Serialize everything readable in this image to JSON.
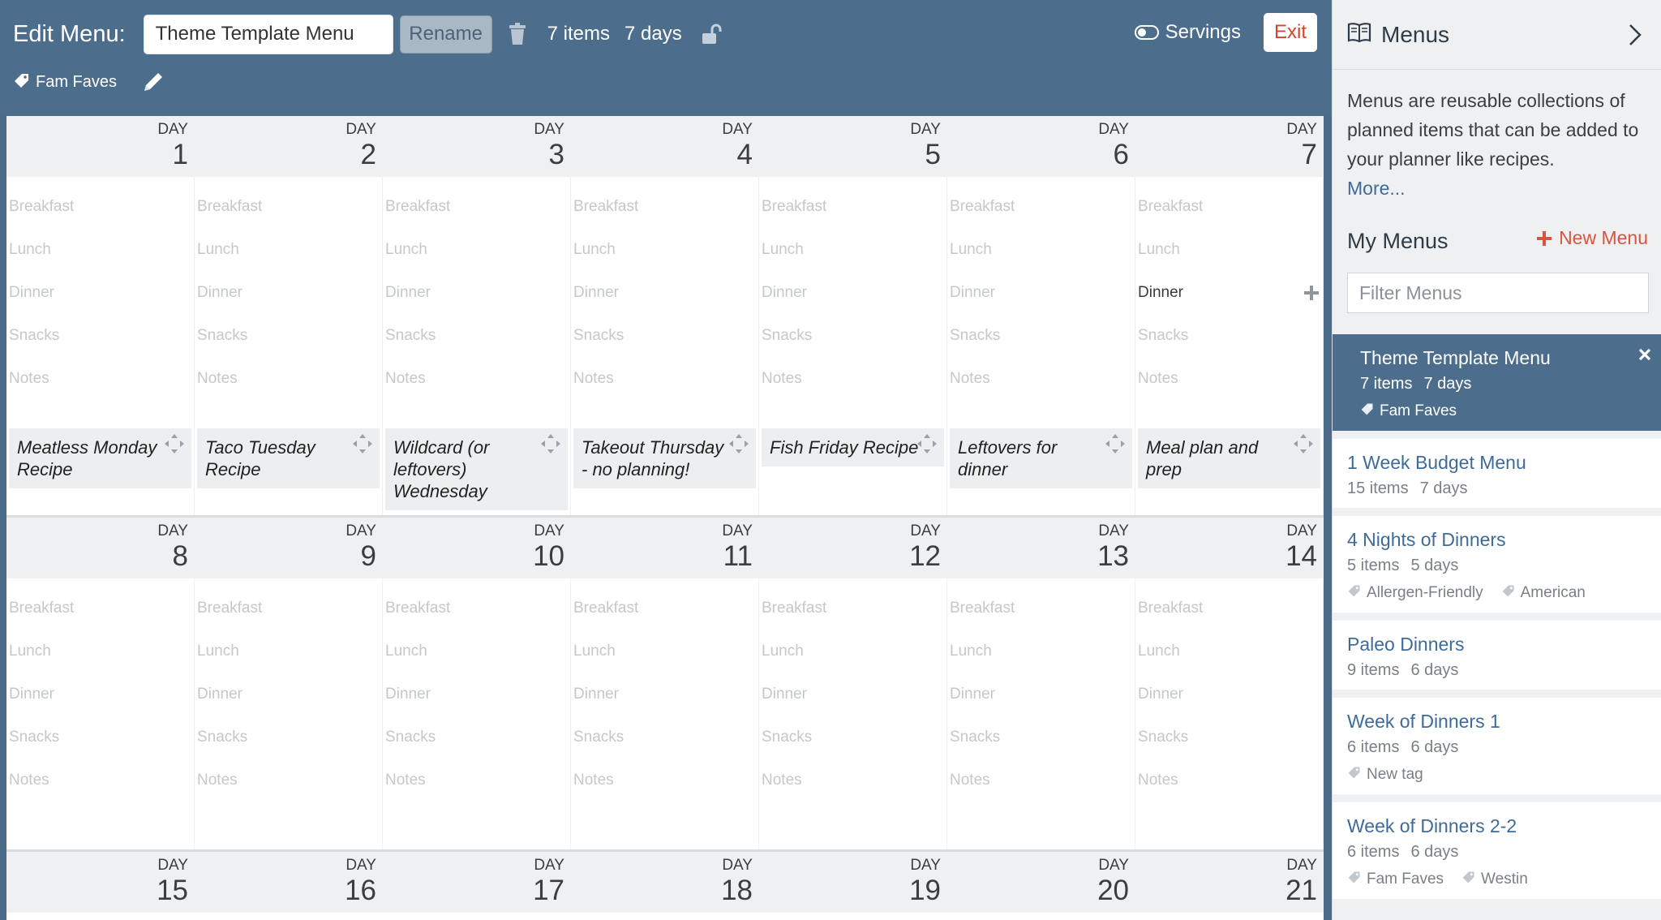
{
  "header": {
    "title": "Edit Menu:",
    "menu_name_value": "Theme Template Menu",
    "rename_label": "Rename",
    "items_count": "7 items",
    "days_count": "7 days",
    "servings_label": "Servings",
    "exit_label": "Exit",
    "tag": "Fam Faves",
    "icons": [
      "trash-icon",
      "unlock-icon",
      "toggle-icon",
      "tag-icon",
      "pencil-icon"
    ]
  },
  "planner": {
    "day_label": "DAY",
    "meal_labels": [
      "Breakfast",
      "Lunch",
      "Dinner",
      "Snacks",
      "Notes"
    ],
    "weeks": [
      {
        "days": [
          {
            "num": "1",
            "note": "Meatless Monday Recipe"
          },
          {
            "num": "2",
            "note": "Taco Tuesday Recipe"
          },
          {
            "num": "3",
            "note": "Wildcard (or leftovers) Wednesday"
          },
          {
            "num": "4",
            "note": "Takeout Thursday - no planning!"
          },
          {
            "num": "5",
            "note": "Fish Friday Recipe"
          },
          {
            "num": "6",
            "note": "Leftovers for dinner"
          },
          {
            "num": "7",
            "note": "Meal plan and prep"
          }
        ]
      },
      {
        "days": [
          {
            "num": "8"
          },
          {
            "num": "9"
          },
          {
            "num": "10"
          },
          {
            "num": "11"
          },
          {
            "num": "12"
          },
          {
            "num": "13"
          },
          {
            "num": "14"
          }
        ]
      },
      {
        "days": [
          {
            "num": "15"
          },
          {
            "num": "16"
          },
          {
            "num": "17"
          },
          {
            "num": "18"
          },
          {
            "num": "19"
          },
          {
            "num": "20"
          },
          {
            "num": "21"
          }
        ]
      }
    ],
    "active_slot": {
      "week": 0,
      "day": 6,
      "meal": "Dinner"
    }
  },
  "sidebar": {
    "title": "Menus",
    "description": "Menus are reusable collections of planned items that can be added to your planner like recipes.",
    "more_link": "More...",
    "my_menus_title": "My Menus",
    "new_menu_label": "New Menu",
    "filter_placeholder": "Filter Menus",
    "menus": [
      {
        "name": "Theme Template Menu",
        "items": "7 items",
        "days": "7 days",
        "tags": [
          "Fam Faves"
        ],
        "selected": true
      },
      {
        "name": "1 Week Budget Menu",
        "items": "15 items",
        "days": "7 days",
        "tags": []
      },
      {
        "name": "4 Nights of Dinners",
        "items": "5 items",
        "days": "5 days",
        "tags": [
          "Allergen-Friendly",
          "American"
        ]
      },
      {
        "name": "Paleo Dinners",
        "items": "9 items",
        "days": "6 days",
        "tags": []
      },
      {
        "name": "Week of Dinners 1",
        "items": "6 items",
        "days": "6 days",
        "tags": [
          "New tag"
        ]
      },
      {
        "name": "Week of Dinners 2-2",
        "items": "6 items",
        "days": "6 days",
        "tags": [
          "Fam Faves",
          "Westin"
        ]
      }
    ]
  },
  "colors": {
    "header_bg": "#4c6e8c",
    "accent_red": "#d9543f",
    "link_blue": "#3e6b99",
    "muted_text": "#c4c8cc"
  }
}
